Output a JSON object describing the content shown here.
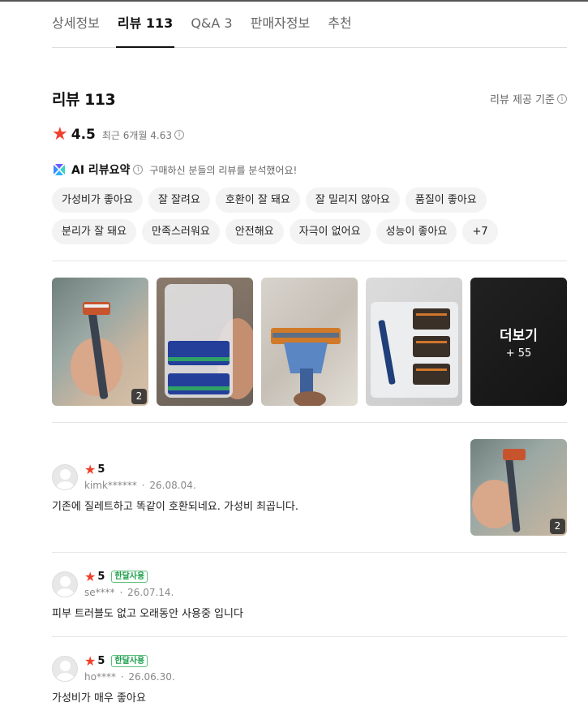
{
  "tabs": [
    {
      "label": "상세정보"
    },
    {
      "label": "리뷰 113"
    },
    {
      "label": "Q&A 3"
    },
    {
      "label": "판매자정보"
    },
    {
      "label": "추천"
    }
  ],
  "review_section": {
    "title": "리뷰 113",
    "criteria": "리뷰 제공 기준",
    "rating": "4.5",
    "recent": "최근 6개월 4.63"
  },
  "ai_summary": {
    "title": "AI 리뷰요약",
    "description": "구매하신 분들의 리뷰를 분석했어요!",
    "keywords_row1": [
      "가성비가 좋아요",
      "잘 잘려요",
      "호환이 잘 돼요",
      "잘 밀리지 않아요",
      "품질이 좋아요"
    ],
    "keywords_row2": [
      "분리가 잘 돼요",
      "만족스러워요",
      "안전해요",
      "자극이 없어요",
      "성능이 좋아요",
      "+7"
    ]
  },
  "photo_strip": {
    "first_badge": "2",
    "more_label": "더보기",
    "more_count": "+ 55"
  },
  "reviews": [
    {
      "score": "5",
      "tag": "",
      "user": "kimk******",
      "date": "26.08.04.",
      "text": "기존에 질레트하고 똑같이 호환되네요. 가성비 최곱니다.",
      "photo_badge": "2"
    },
    {
      "score": "5",
      "tag": "한달사용",
      "user": "se****",
      "date": "26.07.14.",
      "text": "피부 트러블도 없고 오래동안 사용중 입니다"
    },
    {
      "score": "5",
      "tag": "한달사용",
      "user": "ho****",
      "date": "26.06.30.",
      "text": "가성비가 매우 좋아요"
    }
  ],
  "colors": {
    "star": "#f0402a",
    "tag_green": "#1a9e4b"
  }
}
